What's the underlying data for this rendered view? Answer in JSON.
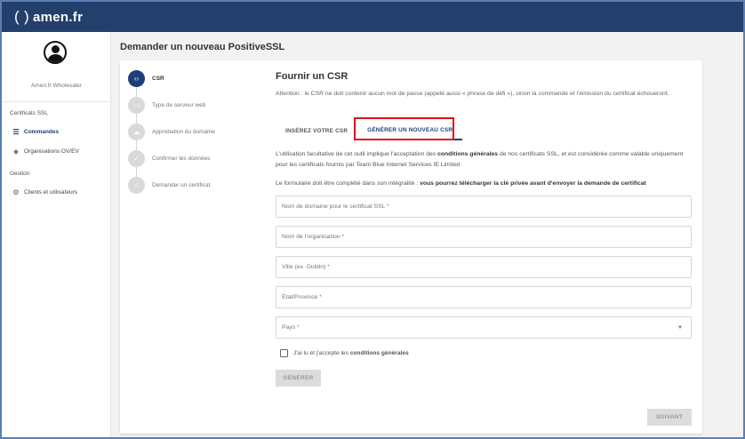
{
  "app": {
    "logo_text": "amen.fr",
    "brand_color": "#233f6b"
  },
  "sidebar": {
    "account_name": "Amen.fr Wholesaler",
    "sections": [
      {
        "title": "Certificats SSL",
        "items": [
          {
            "label": "Commandes",
            "icon": "list-icon",
            "active": true
          },
          {
            "label": "Organisations OV/EV",
            "icon": "layers-icon",
            "active": false
          }
        ]
      },
      {
        "title": "Gestion",
        "items": [
          {
            "label": "Clients et utilisateurs",
            "icon": "gear-icon",
            "active": false
          }
        ]
      }
    ]
  },
  "page": {
    "title": "Demander un nouveau PositiveSSL"
  },
  "stepper": {
    "steps": [
      {
        "label": "CSR",
        "icon": "code-icon",
        "active": true
      },
      {
        "label": "Type de serveur web",
        "icon": "monitor-icon",
        "active": false
      },
      {
        "label": "Approbation du domaine",
        "icon": "cloud-icon",
        "active": false
      },
      {
        "label": "Confirmer les données",
        "icon": "thumb-up-icon",
        "active": false
      },
      {
        "label": "Demander un certificat",
        "icon": "star-icon",
        "active": false
      }
    ]
  },
  "form": {
    "title": "Fournir un CSR",
    "attention": "Attention : le CSR ne doit contenir aucun mot de passe (appelé aussi « phrase de défi »), sinon la commande et l'émission du certificat échoueront.",
    "tabs": [
      {
        "label": "INSÉREZ VOTRE CSR",
        "active": false
      },
      {
        "label": "GÉNÉRER UN NOUVEAU CSR",
        "active": true
      }
    ],
    "info1_pre": "L'utilisation facultative de cet outil implique l'acceptation des ",
    "info1_bold": "conditions générales",
    "info1_post": " de nos certificats SSL, et est considérée comme valable uniquement pour les certificats fournis par Team Blue Internet Services IE Limited",
    "info2_pre": "Le formulaire doit être complété dans son intégralité : ",
    "info2_bold": "vous pourrez télécharger la clé privée avant d'envoyer la demande de certificat",
    "fields": {
      "domain_placeholder": "Nom de domaine pour le certificat SSL *",
      "org_placeholder": "Nom de l'organisation *",
      "city_placeholder": "Ville (ex. Dublin) *",
      "state_placeholder": "État/Province *",
      "country_placeholder": "Pays *"
    },
    "terms_pre": "J'ai lu et j'accepte les ",
    "terms_bold": "conditions générales",
    "generate_button": "GÉNÉRER",
    "next_button": "SUIVANT"
  }
}
